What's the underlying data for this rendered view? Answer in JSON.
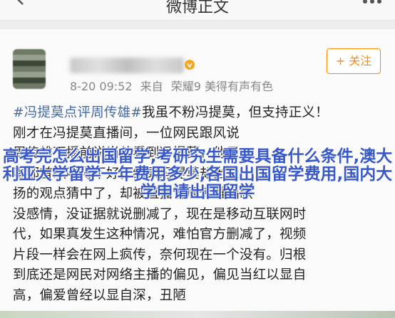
{
  "header": {
    "title": "微博正文",
    "back_icon": "back-arrow-icon",
    "more_icon": "more-icon"
  },
  "post": {
    "time": "8-20 09:52",
    "source_prefix": "来自",
    "device": "荣耀9 美得有声有色",
    "follow_label": "+ 关注",
    "hashtag": "#冯提莫点评周传雄#",
    "body_lines": [
      "我虽不粉冯提莫，但支持正义！",
      "刚才在冯提莫直播间，一位网民跟风说",
      "周传雄下播前说当他看到冯提莫，他只",
      "唱那首歌唱得不好，结果冯提莫却当众",
      "扬的观点猜中了，却被直播说周传雄唱歌",
      "没感情，没证据就说删减了，现在是移动互联网时",
      "代，如果真发生这种情况，难怕官方删减了，视频",
      "片段一样会在网上疯传，奈何现在一个没有。归根",
      "到底还是网民对网络主播的偏见，偏见当红以显自",
      "高，偏爱曾经以显自深，丑陋"
    ]
  },
  "overlay": {
    "text": "高考完怎么出国留学,考研究生需要具备什么条件,澳大利亚大学留学一年费用多少,各国出国留学费用,国内大学申请出国留学"
  },
  "colors": {
    "accent": "#ff8a00",
    "hashtag": "#466a9e",
    "overlay": "#3a59c8"
  }
}
